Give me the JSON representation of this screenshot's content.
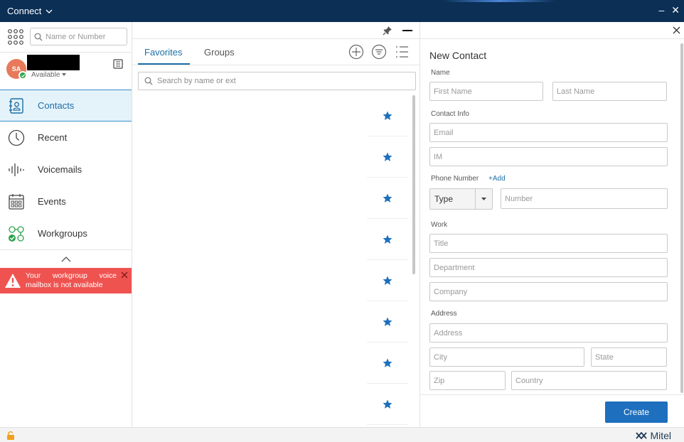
{
  "window": {
    "title": "Connect"
  },
  "sidebar": {
    "search_placeholder": "Name or Number",
    "user": {
      "initials": "SA",
      "status": "Available"
    },
    "nav": [
      {
        "label": "Contacts",
        "icon": "contacts-icon",
        "active": true
      },
      {
        "label": "Recent",
        "icon": "clock-icon",
        "active": false
      },
      {
        "label": "Voicemails",
        "icon": "voicemail-icon",
        "active": false
      },
      {
        "label": "Events",
        "icon": "calendar-icon",
        "active": false
      },
      {
        "label": "Workgroups",
        "icon": "workgroups-icon",
        "active": false
      }
    ],
    "alert": {
      "message": "Your workgroup voice mailbox is not available",
      "color": "#ef5350"
    }
  },
  "favorites": {
    "tabs": [
      {
        "label": "Favorites",
        "active": true
      },
      {
        "label": "Groups",
        "active": false
      }
    ],
    "search_placeholder": "Search by name or ext",
    "rows": [
      {
        "starred": true
      },
      {
        "starred": true
      },
      {
        "starred": true
      },
      {
        "starred": true
      },
      {
        "starred": true
      },
      {
        "starred": true
      },
      {
        "starred": true
      },
      {
        "starred": true
      }
    ]
  },
  "new_contact": {
    "title": "New Contact",
    "sections": {
      "name": "Name",
      "contact_info": "Contact Info",
      "phone": "Phone Number",
      "work": "Work",
      "address": "Address"
    },
    "add_link": "+Add",
    "placeholders": {
      "first_name": "First Name",
      "last_name": "Last Name",
      "email": "Email",
      "im": "IM",
      "number": "Number",
      "title": "Title",
      "department": "Department",
      "company": "Company",
      "address": "Address",
      "city": "City",
      "state": "State",
      "zip": "Zip",
      "country": "Country"
    },
    "type_value": "Type",
    "create_label": "Create"
  },
  "footer": {
    "brand": "Mitel"
  },
  "colors": {
    "titlebar": "#0b2f55",
    "accent": "#1d6fa5",
    "button": "#1e6fbe",
    "presence": "#2da44e"
  }
}
